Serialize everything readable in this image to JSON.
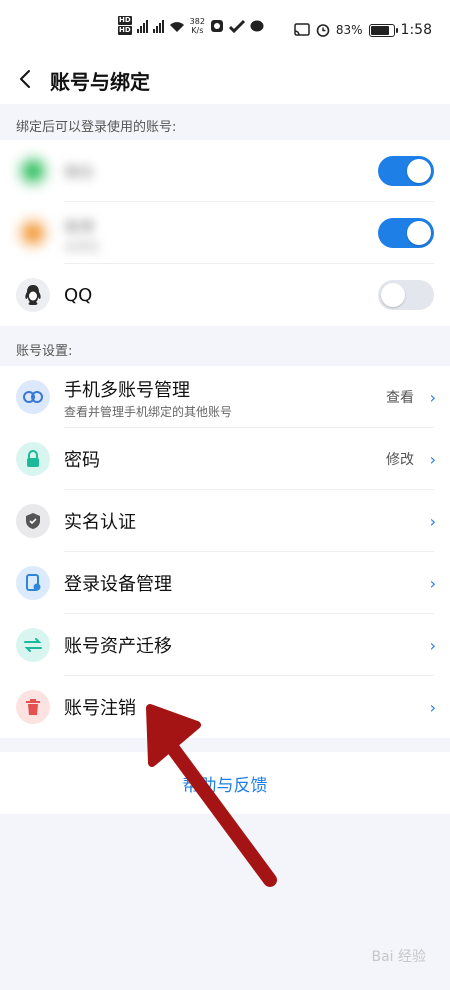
{
  "status_bar": {
    "speed_value": "382",
    "speed_unit": "K/s",
    "battery": "83%",
    "time": "1:58"
  },
  "nav": {
    "title": "账号与绑定"
  },
  "bound_section": {
    "label": "绑定后可以登录使用的账号:",
    "accounts": [
      {
        "name": "微信",
        "sub": "",
        "color": "#3cc46a",
        "toggle": "on",
        "blurred": true
      },
      {
        "name": "微博",
        "sub": "未绑定",
        "color": "#f3a046",
        "toggle": "on",
        "blurred": true
      },
      {
        "name": "QQ",
        "sub": "",
        "color": "#2a2a2a",
        "toggle": "off",
        "blurred": false
      }
    ]
  },
  "settings_section": {
    "label": "账号设置:",
    "items": [
      {
        "title": "手机多账号管理",
        "sub": "查看并管理手机绑定的其他账号",
        "value": "查看",
        "icon": "link-icon",
        "icon_bg": "#dce8fb",
        "icon_color": "#3a78d8"
      },
      {
        "title": "密码",
        "sub": "",
        "value": "修改",
        "icon": "lock-icon",
        "icon_bg": "#d9f5f0",
        "icon_color": "#19b99a"
      },
      {
        "title": "实名认证",
        "sub": "",
        "value": "",
        "icon": "shield-icon",
        "icon_bg": "#e9e9ec",
        "icon_color": "#555"
      },
      {
        "title": "登录设备管理",
        "sub": "",
        "value": "",
        "icon": "device-icon",
        "icon_bg": "#dcebfb",
        "icon_color": "#2f86d6"
      },
      {
        "title": "账号资产迁移",
        "sub": "",
        "value": "",
        "icon": "transfer-icon",
        "icon_bg": "#d9f5f0",
        "icon_color": "#19b99a"
      },
      {
        "title": "账号注销",
        "sub": "",
        "value": "",
        "icon": "trash-icon",
        "icon_bg": "#fde2e2",
        "icon_color": "#e55050"
      }
    ]
  },
  "help": {
    "label": "帮助与反馈"
  },
  "watermark": {
    "text": "Bai 经验"
  },
  "colors": {
    "accent": "#1e7fe6",
    "arrow": "#a51414"
  }
}
